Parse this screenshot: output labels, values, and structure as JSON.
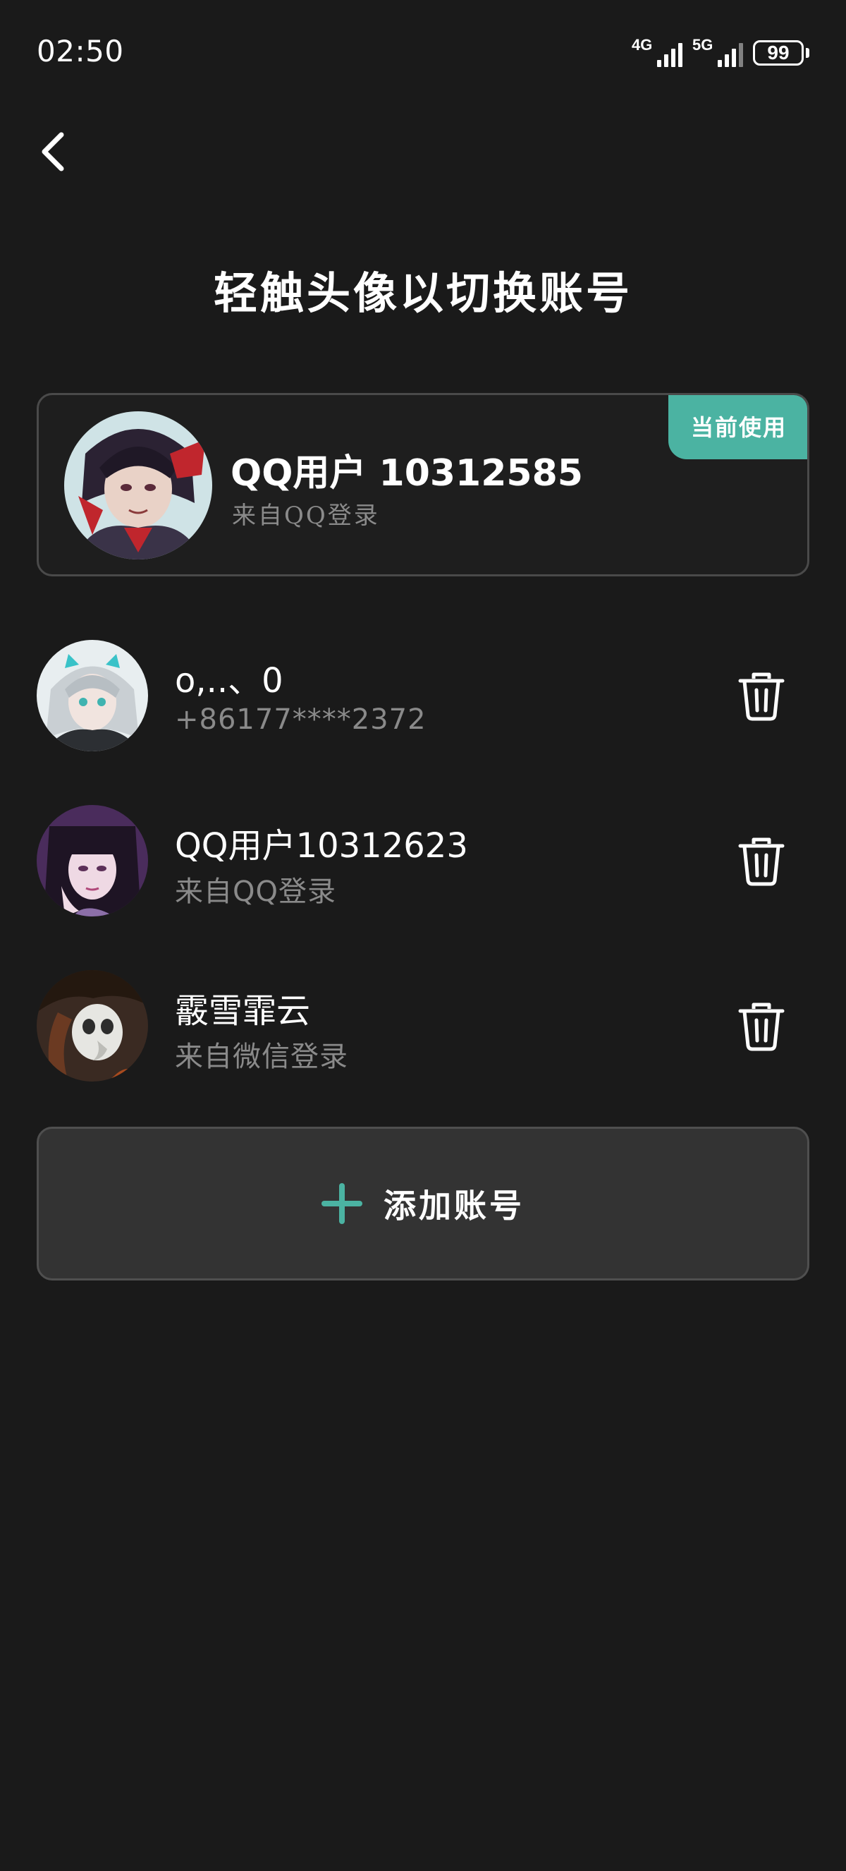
{
  "status_bar": {
    "time": "02:50",
    "signal_1_label": "4G",
    "signal_2_label": "5G",
    "battery": "99"
  },
  "header": {
    "back_icon": "chevron-left-icon"
  },
  "title": "轻触头像以切换账号",
  "current_account": {
    "badge": "当前使用",
    "name": "QQ用户 10312585",
    "source": "来自QQ登录"
  },
  "accounts": [
    {
      "name": "o,..、0",
      "detail": "+86177****2372"
    },
    {
      "name": "QQ用户10312623",
      "detail": "来自QQ登录"
    },
    {
      "name": "霰雪霏云",
      "detail": "来自微信登录"
    }
  ],
  "add_account": {
    "label": "添加账号",
    "icon": "plus-icon"
  },
  "colors": {
    "background": "#1a1a1a",
    "accent": "#4bb3a2",
    "card_border": "#4a4a4a",
    "secondary_text": "#8a8a8a",
    "add_button_bg": "#333333"
  }
}
